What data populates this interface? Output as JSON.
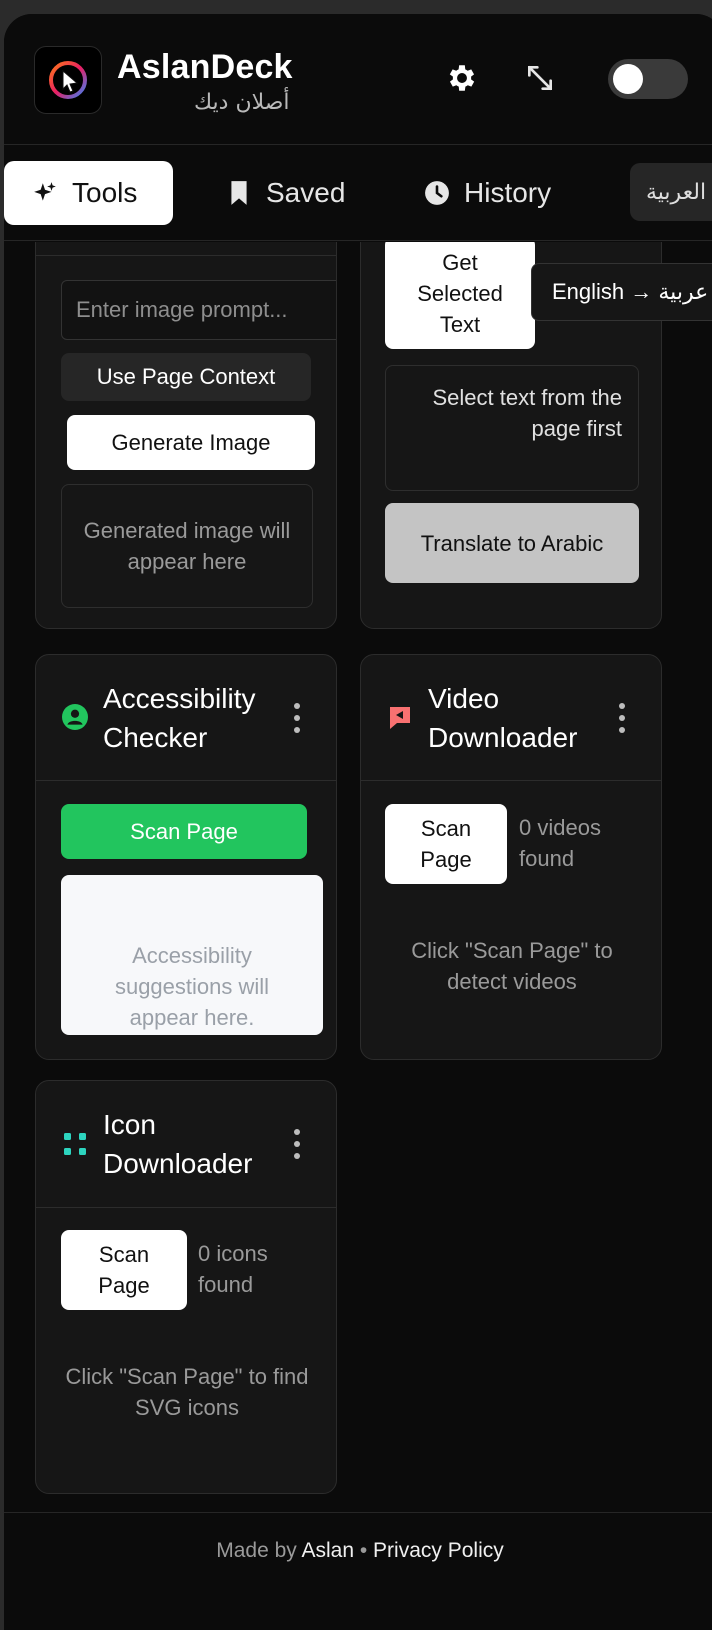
{
  "app": {
    "title": "AslanDeck",
    "subtitle": "أصلان ديك",
    "icons": {
      "settings": "gear-icon",
      "expand": "expand-icon"
    },
    "theme_toggle": "off"
  },
  "tabs": [
    {
      "label": "Tools",
      "icon": "sparkles-icon",
      "active": true
    },
    {
      "label": "Saved",
      "icon": "bookmark-icon",
      "active": false
    },
    {
      "label": "History",
      "icon": "clock-icon",
      "active": false
    }
  ],
  "language_button": "العربية",
  "image_generator": {
    "prompt_placeholder": "Enter image prompt...",
    "use_context_label": "Use Page Context",
    "generate_label": "Generate Image",
    "output_placeholder": "Generated image will appear here"
  },
  "translator": {
    "get_selected_label": "Get Selected Text",
    "direction_label": "English → عربية",
    "selection_hint": "Select text from the page first",
    "translate_label": "Translate to Arabic"
  },
  "accessibility": {
    "title": "Accessibility Checker",
    "icon": "person-circle-icon",
    "scan_label": "Scan Page",
    "result_placeholder": "Accessibility suggestions will appear here.",
    "accent": "#22c55e"
  },
  "video": {
    "title": "Video Downloader",
    "icon": "video-chat-icon",
    "scan_label": "Scan Page",
    "count_text": "0 videos found",
    "hint": "Click \"Scan Page\" to detect videos",
    "accent": "#f87171"
  },
  "icons_tool": {
    "title": "Icon Downloader",
    "icon": "grid-dots-icon",
    "scan_label": "Scan Page",
    "count_text": "0 icons found",
    "hint": "Click \"Scan Page\" to find SVG icons",
    "accent": "#2dd4bf"
  },
  "footer": {
    "made_by": "Made by",
    "author": "Aslan",
    "separator": "•",
    "privacy": "Privacy Policy"
  }
}
